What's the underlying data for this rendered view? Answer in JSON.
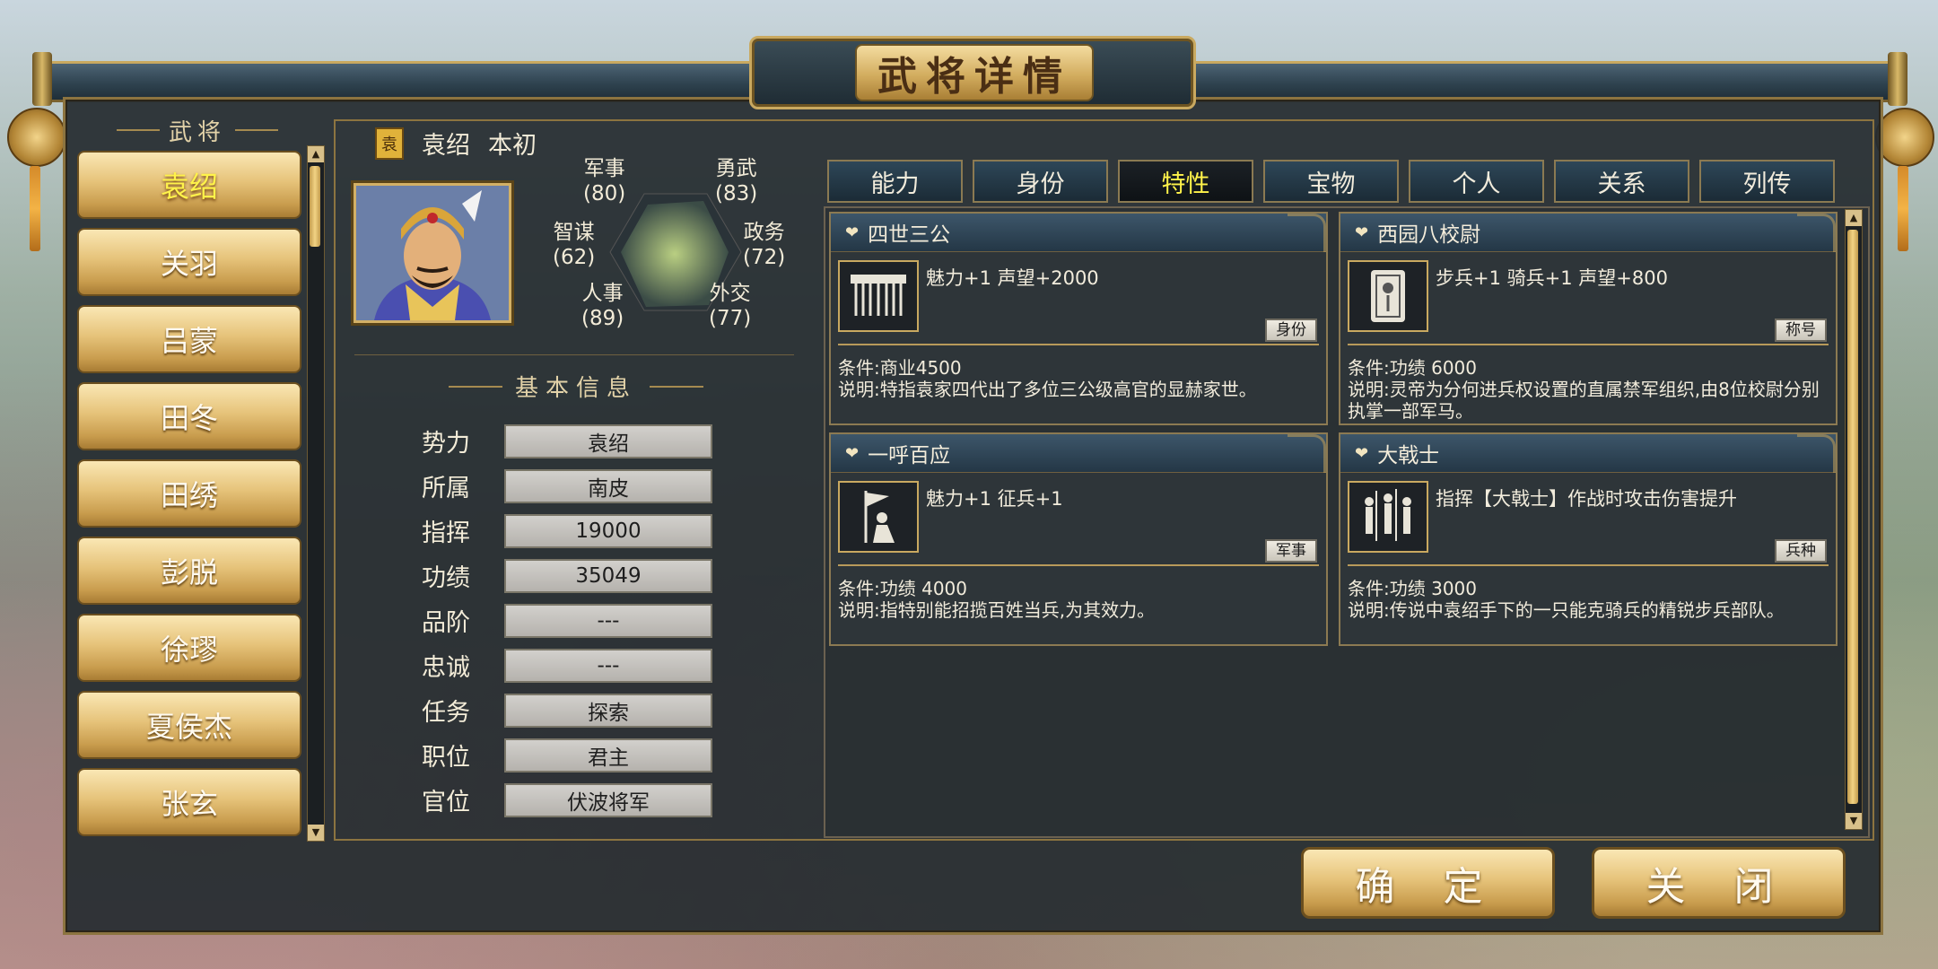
{
  "window": {
    "title": "武将详情"
  },
  "sidebar": {
    "header": "武将",
    "generals": [
      "袁绍",
      "关羽",
      "吕蒙",
      "田冬",
      "田绣",
      "彭脱",
      "徐璆",
      "夏侯杰",
      "张玄"
    ],
    "selected_index": 0
  },
  "general": {
    "seal": "袁",
    "name": "袁绍",
    "style_name": "本初",
    "stats": [
      {
        "label": "军事",
        "value": "(80)"
      },
      {
        "label": "勇武",
        "value": "(83)"
      },
      {
        "label": "智谋",
        "value": "(62)"
      },
      {
        "label": "政务",
        "value": "(72)"
      },
      {
        "label": "人事",
        "value": "(89)"
      },
      {
        "label": "外交",
        "value": "(77)"
      }
    ]
  },
  "basic_info": {
    "title": "基本信息",
    "fields": [
      {
        "label": "势力",
        "value": "袁绍"
      },
      {
        "label": "所属",
        "value": "南皮"
      },
      {
        "label": "指挥",
        "value": "19000"
      },
      {
        "label": "功绩",
        "value": "35049"
      },
      {
        "label": "品阶",
        "value": "---"
      },
      {
        "label": "忠诚",
        "value": "---"
      },
      {
        "label": "任务",
        "value": "探索"
      },
      {
        "label": "职位",
        "value": "君主"
      },
      {
        "label": "官位",
        "value": "伏波将军"
      }
    ]
  },
  "tabs": [
    "能力",
    "身份",
    "特性",
    "宝物",
    "个人",
    "关系",
    "列传"
  ],
  "active_tab": "特性",
  "traits": [
    {
      "name": "四世三公",
      "icon": "curtain-icon",
      "effect": "魅力+1 声望+2000",
      "tag": "身份",
      "condition": "条件:商业4500",
      "description": "说明:特指袁家四代出了多位三公级高官的显赫家世。"
    },
    {
      "name": "西园八校尉",
      "icon": "badge-icon",
      "effect": "步兵+1 骑兵+1 声望+800",
      "tag": "称号",
      "condition": "条件:功绩 6000",
      "description": "说明:灵帝为分何进兵权设置的直属禁军组织,由8位校尉分别执掌一部军马。"
    },
    {
      "name": "一呼百应",
      "icon": "flag-bearer-icon",
      "effect": "魅力+1 征兵+1",
      "tag": "军事",
      "condition": "条件:功绩 4000",
      "description": "说明:指特别能招揽百姓当兵,为其效力。"
    },
    {
      "name": "大戟士",
      "icon": "soldiers-icon",
      "effect": "指挥【大戟士】作战时攻击伤害提升",
      "tag": "兵种",
      "condition": "条件:功绩 3000",
      "description": "说明:传说中袁绍手下的一只能克骑兵的精锐步兵部队。"
    }
  ],
  "buttons": {
    "confirm": "确 定",
    "close": "关 闭"
  },
  "colors": {
    "gold": "#c9a960",
    "active_text": "#fff34a",
    "panel": "#262c30"
  }
}
